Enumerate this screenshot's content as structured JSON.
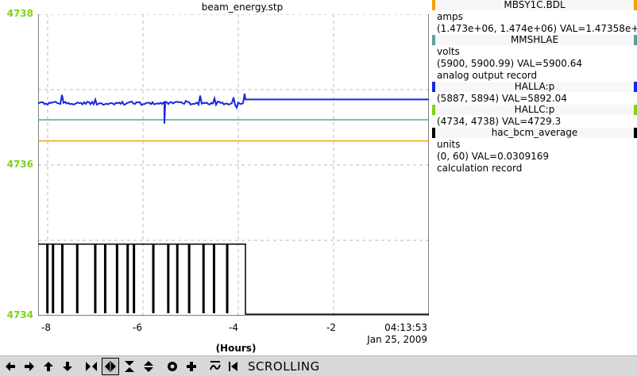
{
  "window": {
    "title": "beam_energy.stp"
  },
  "plot": {
    "y_ticks": [
      "4738",
      "4736",
      "4734"
    ],
    "x_ticks": [
      "-8",
      "-6",
      "-4",
      "-2"
    ],
    "time_label_line1": "04:13:53",
    "time_label_line2": "Jan 25, 2009",
    "x_axis_label": "(Hours)",
    "colors": {
      "MBSY1C.BDL": "#f5a000",
      "MMSHLAE": "#5aa0a0",
      "HALLA:p": "#1a26e0",
      "HALLC:p": "#7bd31a",
      "hac_bcm_average": "#000000"
    }
  },
  "chart_data": {
    "type": "line",
    "title": "beam_energy.stp",
    "xlabel": "(Hours)",
    "ylabel": "",
    "xlim": [
      -8.2,
      0
    ],
    "ylim": [
      4734,
      4738
    ],
    "series": [
      {
        "name": "MBSY1C.BDL",
        "color": "#f5a000",
        "x": [
          -8.2,
          0
        ],
        "y": [
          4736.32,
          4736.32
        ]
      },
      {
        "name": "MMSHLAE",
        "color": "#5aa0a0",
        "x": [
          -8.2,
          0
        ],
        "y": [
          4736.6,
          4736.6
        ]
      },
      {
        "name": "HALLA:p",
        "color": "#1a26e0",
        "x": [
          -8.2,
          -7.8,
          -7.5,
          -7.2,
          -6.9,
          -6.6,
          -6.3,
          -6.0,
          -5.7,
          -5.55,
          -5.4,
          -5.1,
          -4.8,
          -4.5,
          -4.2,
          -3.9,
          -3.85,
          0
        ],
        "y": [
          4736.82,
          4736.81,
          4736.84,
          4736.8,
          4736.83,
          4736.81,
          4736.85,
          4736.82,
          4736.8,
          4736.55,
          4736.83,
          4736.81,
          4736.84,
          4736.82,
          4736.81,
          4736.83,
          4736.87,
          4736.87
        ]
      },
      {
        "name": "hac_bcm_average",
        "color": "#000000",
        "x": [
          -8.2,
          -3.85,
          -3.85,
          0
        ],
        "y": [
          4734.95,
          4734.95,
          4734.02,
          4734.02
        ]
      }
    ]
  },
  "legend": [
    {
      "name": "MBSY1C.BDL",
      "color": "#f5a000",
      "lines": [
        "amps",
        "(1.473e+06, 1.474e+06)  VAL=1.47358e+06"
      ]
    },
    {
      "name": "MMSHLAE",
      "color": "#5aa0a0",
      "lines": [
        "volts",
        "(5900, 5900.99) VAL=5900.64",
        "analog output record"
      ]
    },
    {
      "name": "HALLA:p",
      "color": "#1a26e0",
      "lines": [
        "(5887, 5894) VAL=5892.04"
      ]
    },
    {
      "name": "HALLC:p",
      "color": "#7bd31a",
      "lines": [
        "(4734, 4738) VAL=4729.3"
      ]
    },
    {
      "name": "hac_bcm_average",
      "color": "#000000",
      "lines": [
        "units",
        "(0, 60) VAL=0.0309169",
        "calculation record"
      ]
    }
  ],
  "toolbar": {
    "buttons": [
      "arrow-left-icon",
      "arrow-right-icon",
      "arrow-up-icon",
      "arrow-down-icon",
      "zoom-in-horizontal-icon",
      "zoom-out-horizontal-icon",
      "zoom-in-vertical-icon",
      "zoom-out-vertical-icon",
      "reset-icon",
      "add-icon",
      "scale-icon",
      "scroll-mode-icon"
    ],
    "mode_label": "SCROLLING"
  }
}
